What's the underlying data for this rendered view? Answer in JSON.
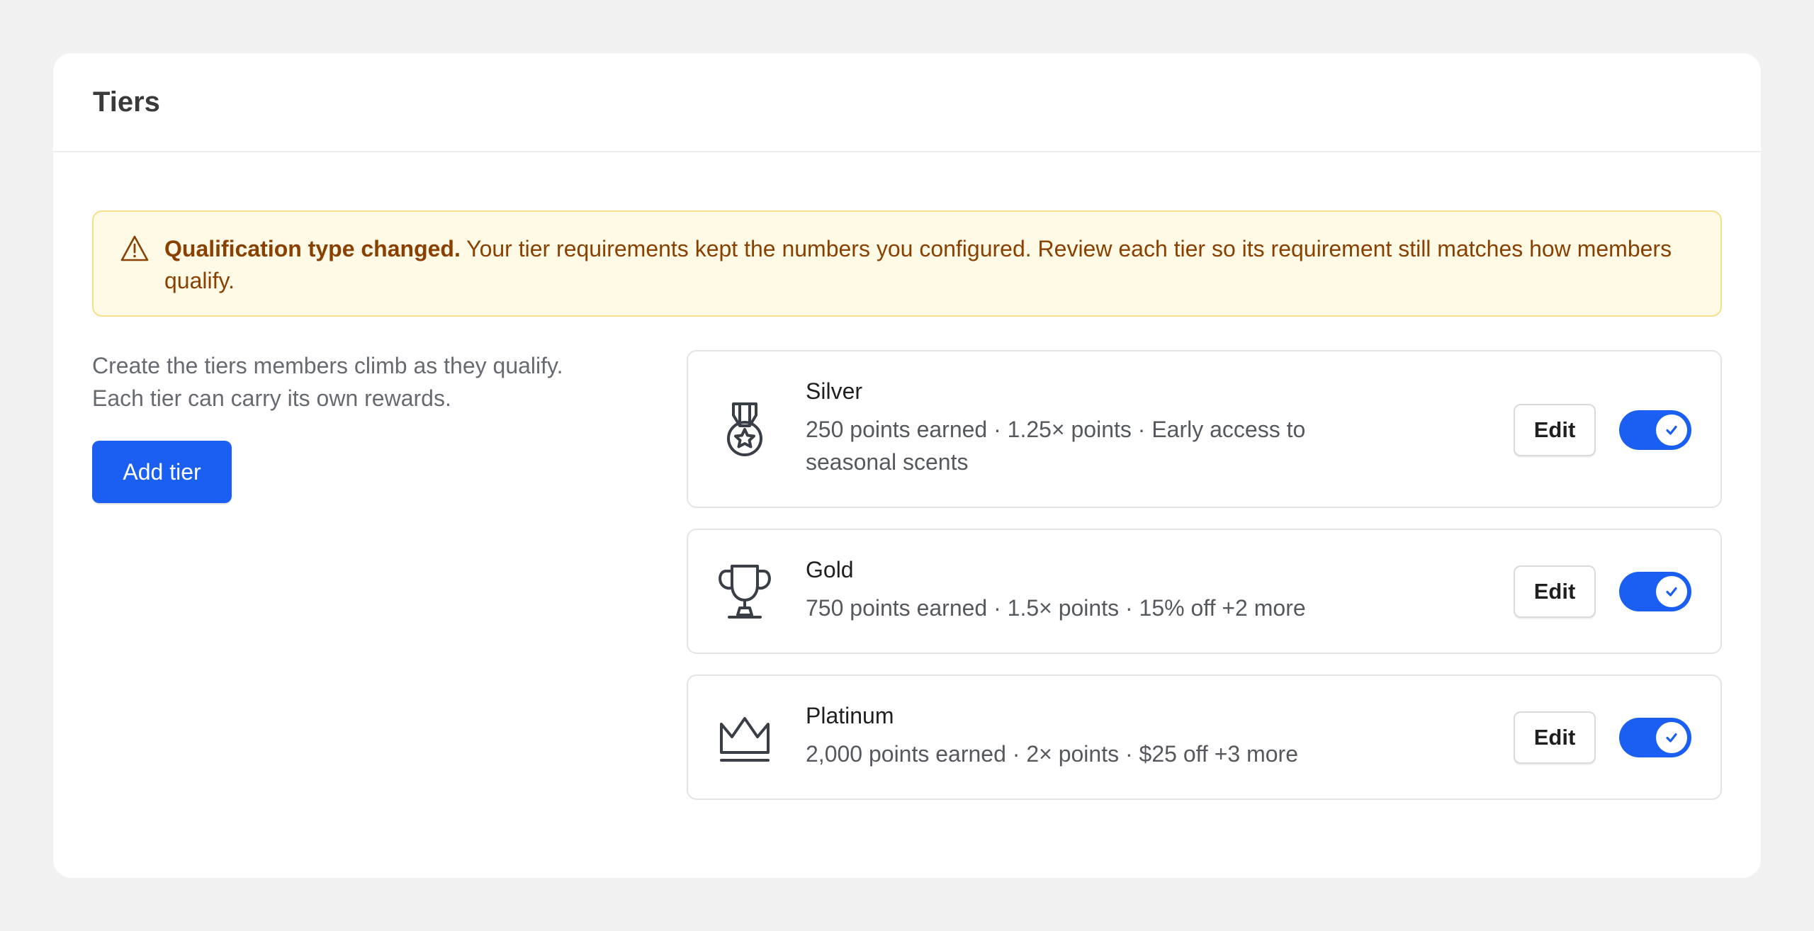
{
  "header": {
    "title": "Tiers"
  },
  "banner": {
    "icon": "warning-triangle-icon",
    "title": "Qualification type changed.",
    "message": "Your tier requirements kept the numbers you configured. Review each tier so its requirement still matches how members qualify."
  },
  "intro": {
    "line1": "Create the tiers members climb as they qualify.",
    "line2": "Each tier can carry its own rewards."
  },
  "add_button": {
    "label": "Add tier"
  },
  "tiers": [
    {
      "name": "Silver",
      "description": "250 points earned · 1.25× points · Early access to seasonal scents",
      "icon": "medal-icon",
      "edit_label": "Edit",
      "enabled": true
    },
    {
      "name": "Gold",
      "description": "750 points earned · 1.5× points · 15% off +2 more",
      "icon": "trophy-icon",
      "edit_label": "Edit",
      "enabled": true
    },
    {
      "name": "Platinum",
      "description": "2,000 points earned · 2× points · $25 off +3 more",
      "icon": "crown-icon",
      "edit_label": "Edit",
      "enabled": true
    }
  ],
  "colors": {
    "accent": "#1a5ff2",
    "warning_bg": "#fefae6",
    "warning_border": "#f4e08b",
    "warning_text": "#8a4000"
  }
}
